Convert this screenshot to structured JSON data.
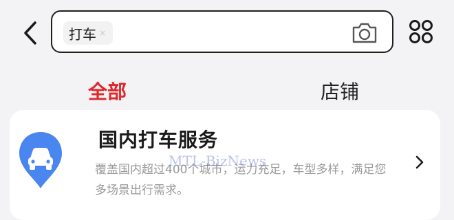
{
  "search": {
    "chip_label": "打车",
    "chip_close": "×"
  },
  "tabs": [
    {
      "label": "全部",
      "active": true
    },
    {
      "label": "店铺",
      "active": false
    }
  ],
  "result": {
    "title": "国内打车服务",
    "description": "覆盖国内超过400个城市，运力充足，车型多样，满足您多场景出行需求。",
    "icon": "car-location-pin-icon"
  },
  "watermark": "MTL-BizNews",
  "colors": {
    "accent": "#e0262a",
    "icon_blue": "#4a86f0",
    "page_background": "#f3f3f5"
  },
  "icons": {
    "back": "chevron-left-icon",
    "camera": "camera-icon",
    "more": "grid-four-circles-icon",
    "row_arrow": "chevron-right-icon"
  }
}
